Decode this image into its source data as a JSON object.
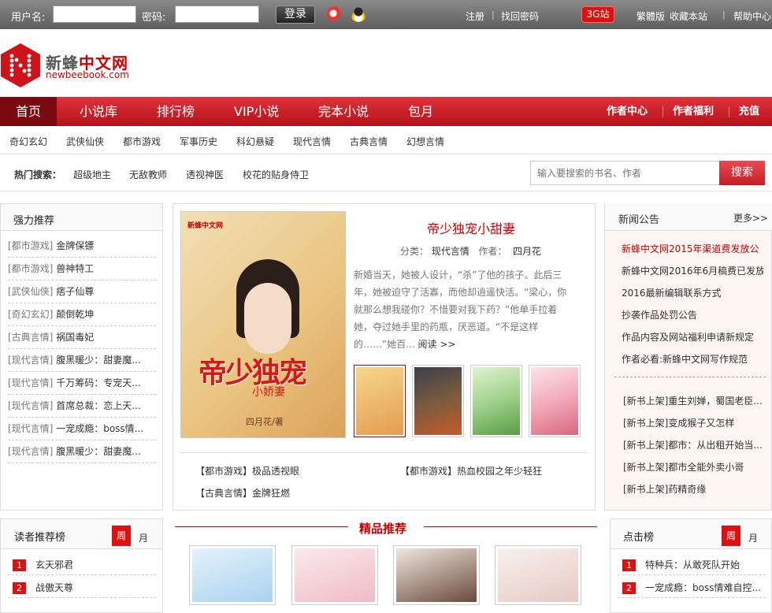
{
  "topbar": {
    "username_label": "用户名:",
    "password_label": "密码:",
    "login": "登录",
    "register": "注册",
    "find_password": "找回密码",
    "btn_3g": "3G站",
    "traditional": "繁體版",
    "favorite": "收藏本站",
    "help": "帮助中心"
  },
  "logo": {
    "cn_a": "新蜂",
    "cn_b": "中文网",
    "en": "newbeebook.com"
  },
  "nav": {
    "items": [
      "首页",
      "小说库",
      "排行榜",
      "VIP小说",
      "完本小说",
      "包月"
    ],
    "right": [
      "作者中心",
      "作者福利",
      "充值"
    ]
  },
  "subnav": [
    "奇幻玄幻",
    "武侠仙侠",
    "都市游戏",
    "军事历史",
    "科幻悬疑",
    "现代言情",
    "古典言情",
    "幻想言情"
  ],
  "hot": {
    "title": "热门搜索：",
    "keywords": [
      "超级地主",
      "无敌教师",
      "透视神医",
      "校花的贴身侍卫"
    ]
  },
  "search": {
    "placeholder": "输入要搜索的书名、作者",
    "button": "搜索"
  },
  "recommend": {
    "title": "强力推荐",
    "items": [
      {
        "cat": "[都市游戏]",
        "name": "金牌保镖"
      },
      {
        "cat": "[都市游戏]",
        "name": "兽神特工"
      },
      {
        "cat": "[武侠仙侠]",
        "name": "痞子仙尊"
      },
      {
        "cat": "[奇幻玄幻]",
        "name": "颠倒乾坤"
      },
      {
        "cat": "[古典言情]",
        "name": "祸国毒妃"
      },
      {
        "cat": "[现代言情]",
        "name": "腹黑暖少：甜妻魔..."
      },
      {
        "cat": "[现代言情]",
        "name": "千万筹码：专宠天..."
      },
      {
        "cat": "[现代言情]",
        "name": "首席总裁：恋上天..."
      },
      {
        "cat": "[现代言情]",
        "name": "一宠成瘾：boss情..."
      },
      {
        "cat": "[现代言情]",
        "name": "腹黑暖少：甜妻魔..."
      }
    ]
  },
  "featured": {
    "title": "帝少独宠小甜妻",
    "category_label": "分类：",
    "category": "现代言情",
    "author_label": "作者：",
    "author": "四月花",
    "desc": "新婚当天，她被人设计，“杀”了他的孩子。此后三年，她被迫守了活寡，而他却逍遥快活。“梁心，你就那么想我碰你？不惜要对我下药？”他单手拉着她，夺过她手里的药瓶，厌恶道。“不是这样的……”她百...",
    "read": "阅读 >>",
    "cover_title": "帝少独宠",
    "cover_sub": "小娇妻",
    "cover_author": "四月花/著",
    "cover_brand": "新蜂中文网",
    "links": [
      "【都市游戏】极品透视眼",
      "【都市游戏】热血校园之年少轻狂",
      "【古典言情】金牌狂燃"
    ]
  },
  "news": {
    "title": "新闻公告",
    "more": "更多>>",
    "items": [
      "新蜂中文网2015年渠道费发放公",
      "新蜂中文网2016年6月稿费已发放",
      "2016最新编辑联系方式",
      "抄袭作品处罚公告",
      "作品内容及网站福利申请新规定",
      "作者必看:新蜂中文网写作规范"
    ],
    "new_books": [
      "[新书上架]重生刘婵，蜀国老臣...",
      "[新书上架]变成猴子又怎样",
      "[新书上架]都市：从出租开始当...",
      "[新书上架]都市全能外卖小哥",
      "[新书上架]药精奇缘"
    ]
  },
  "reader_rank": {
    "title": "读者推荐榜",
    "tab_week": "周",
    "tab_month": "月",
    "items": [
      "玄天邪君",
      "战傲天尊"
    ]
  },
  "premium": {
    "title": "精品推荐"
  },
  "click_rank": {
    "title": "点击榜",
    "tab_week": "周",
    "tab_month": "月",
    "items": [
      "特种兵：从敢死队开始",
      "一宠成瘾：boss情难自控..."
    ]
  },
  "colors": {
    "accent": "#cc1119",
    "nav_dark": "#7a0a0f"
  }
}
